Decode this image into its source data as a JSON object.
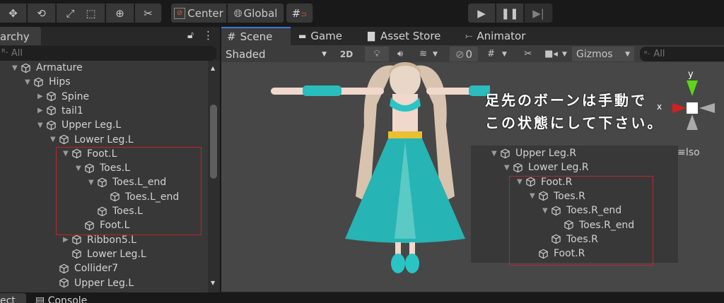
{
  "toolbar": {
    "tools": [
      "move-tool",
      "rotate-tool",
      "scale-tool",
      "rect-tool",
      "transform-tool",
      "custom-tool"
    ],
    "pivot": "Center",
    "space": "Global"
  },
  "play": {
    "play": "play",
    "pause": "pause",
    "step": "step"
  },
  "hierarchy": {
    "tab": "archy",
    "search_placeholder": "All",
    "rows": [
      {
        "label": "Armature",
        "level": 0,
        "arrow": "down"
      },
      {
        "label": "Hips",
        "level": 1,
        "arrow": "down"
      },
      {
        "label": "Spine",
        "level": 2,
        "arrow": "right"
      },
      {
        "label": "tail1",
        "level": 2,
        "arrow": "right"
      },
      {
        "label": "Upper Leg.L",
        "level": 2,
        "arrow": "down"
      },
      {
        "label": "Lower Leg.L",
        "level": 3,
        "arrow": "down"
      },
      {
        "label": "Foot.L",
        "level": 4,
        "arrow": "down"
      },
      {
        "label": "Toes.L",
        "level": 5,
        "arrow": "down"
      },
      {
        "label": "Toes.L_end",
        "level": 6,
        "arrow": "down"
      },
      {
        "label": "Toes.L_end",
        "level": 7,
        "arrow": ""
      },
      {
        "label": "Toes.L",
        "level": 6,
        "arrow": ""
      },
      {
        "label": "Foot.L",
        "level": 5,
        "arrow": ""
      },
      {
        "label": "Ribbon5.L",
        "level": 4,
        "arrow": "right"
      },
      {
        "label": "Lower Leg.L",
        "level": 4,
        "arrow": ""
      },
      {
        "label": "Collider7",
        "level": 3,
        "arrow": ""
      },
      {
        "label": "Upper Leg.L",
        "level": 3,
        "arrow": ""
      }
    ]
  },
  "scene": {
    "tabs": [
      "Scene",
      "Game",
      "Asset Store",
      "Animator"
    ],
    "shading": "Shaded",
    "mode_2d": "2D",
    "hidden_count": "0",
    "gizmos": "Gizmos",
    "search_placeholder": "All",
    "iso": "Iso",
    "axis_y": "y",
    "axis_x": "x",
    "annotation": [
      "足先のボーンは手動で",
      "この状態にして下さい。"
    ],
    "right_rows": [
      {
        "label": "Upper Leg.R",
        "level": 0,
        "arrow": "down"
      },
      {
        "label": "Lower Leg.R",
        "level": 1,
        "arrow": "down"
      },
      {
        "label": "Foot.R",
        "level": 2,
        "arrow": "down"
      },
      {
        "label": "Toes.R",
        "level": 3,
        "arrow": "down"
      },
      {
        "label": "Toes.R_end",
        "level": 4,
        "arrow": "down"
      },
      {
        "label": "Toes.R_end",
        "level": 5,
        "arrow": ""
      },
      {
        "label": "Toes.R",
        "level": 4,
        "arrow": ""
      },
      {
        "label": "Foot.R",
        "level": 3,
        "arrow": ""
      }
    ]
  },
  "bottom": {
    "tabs": [
      "ect",
      "Console"
    ]
  },
  "colors": {
    "highlight": "#c0252a",
    "accent": "#3a79d6"
  }
}
